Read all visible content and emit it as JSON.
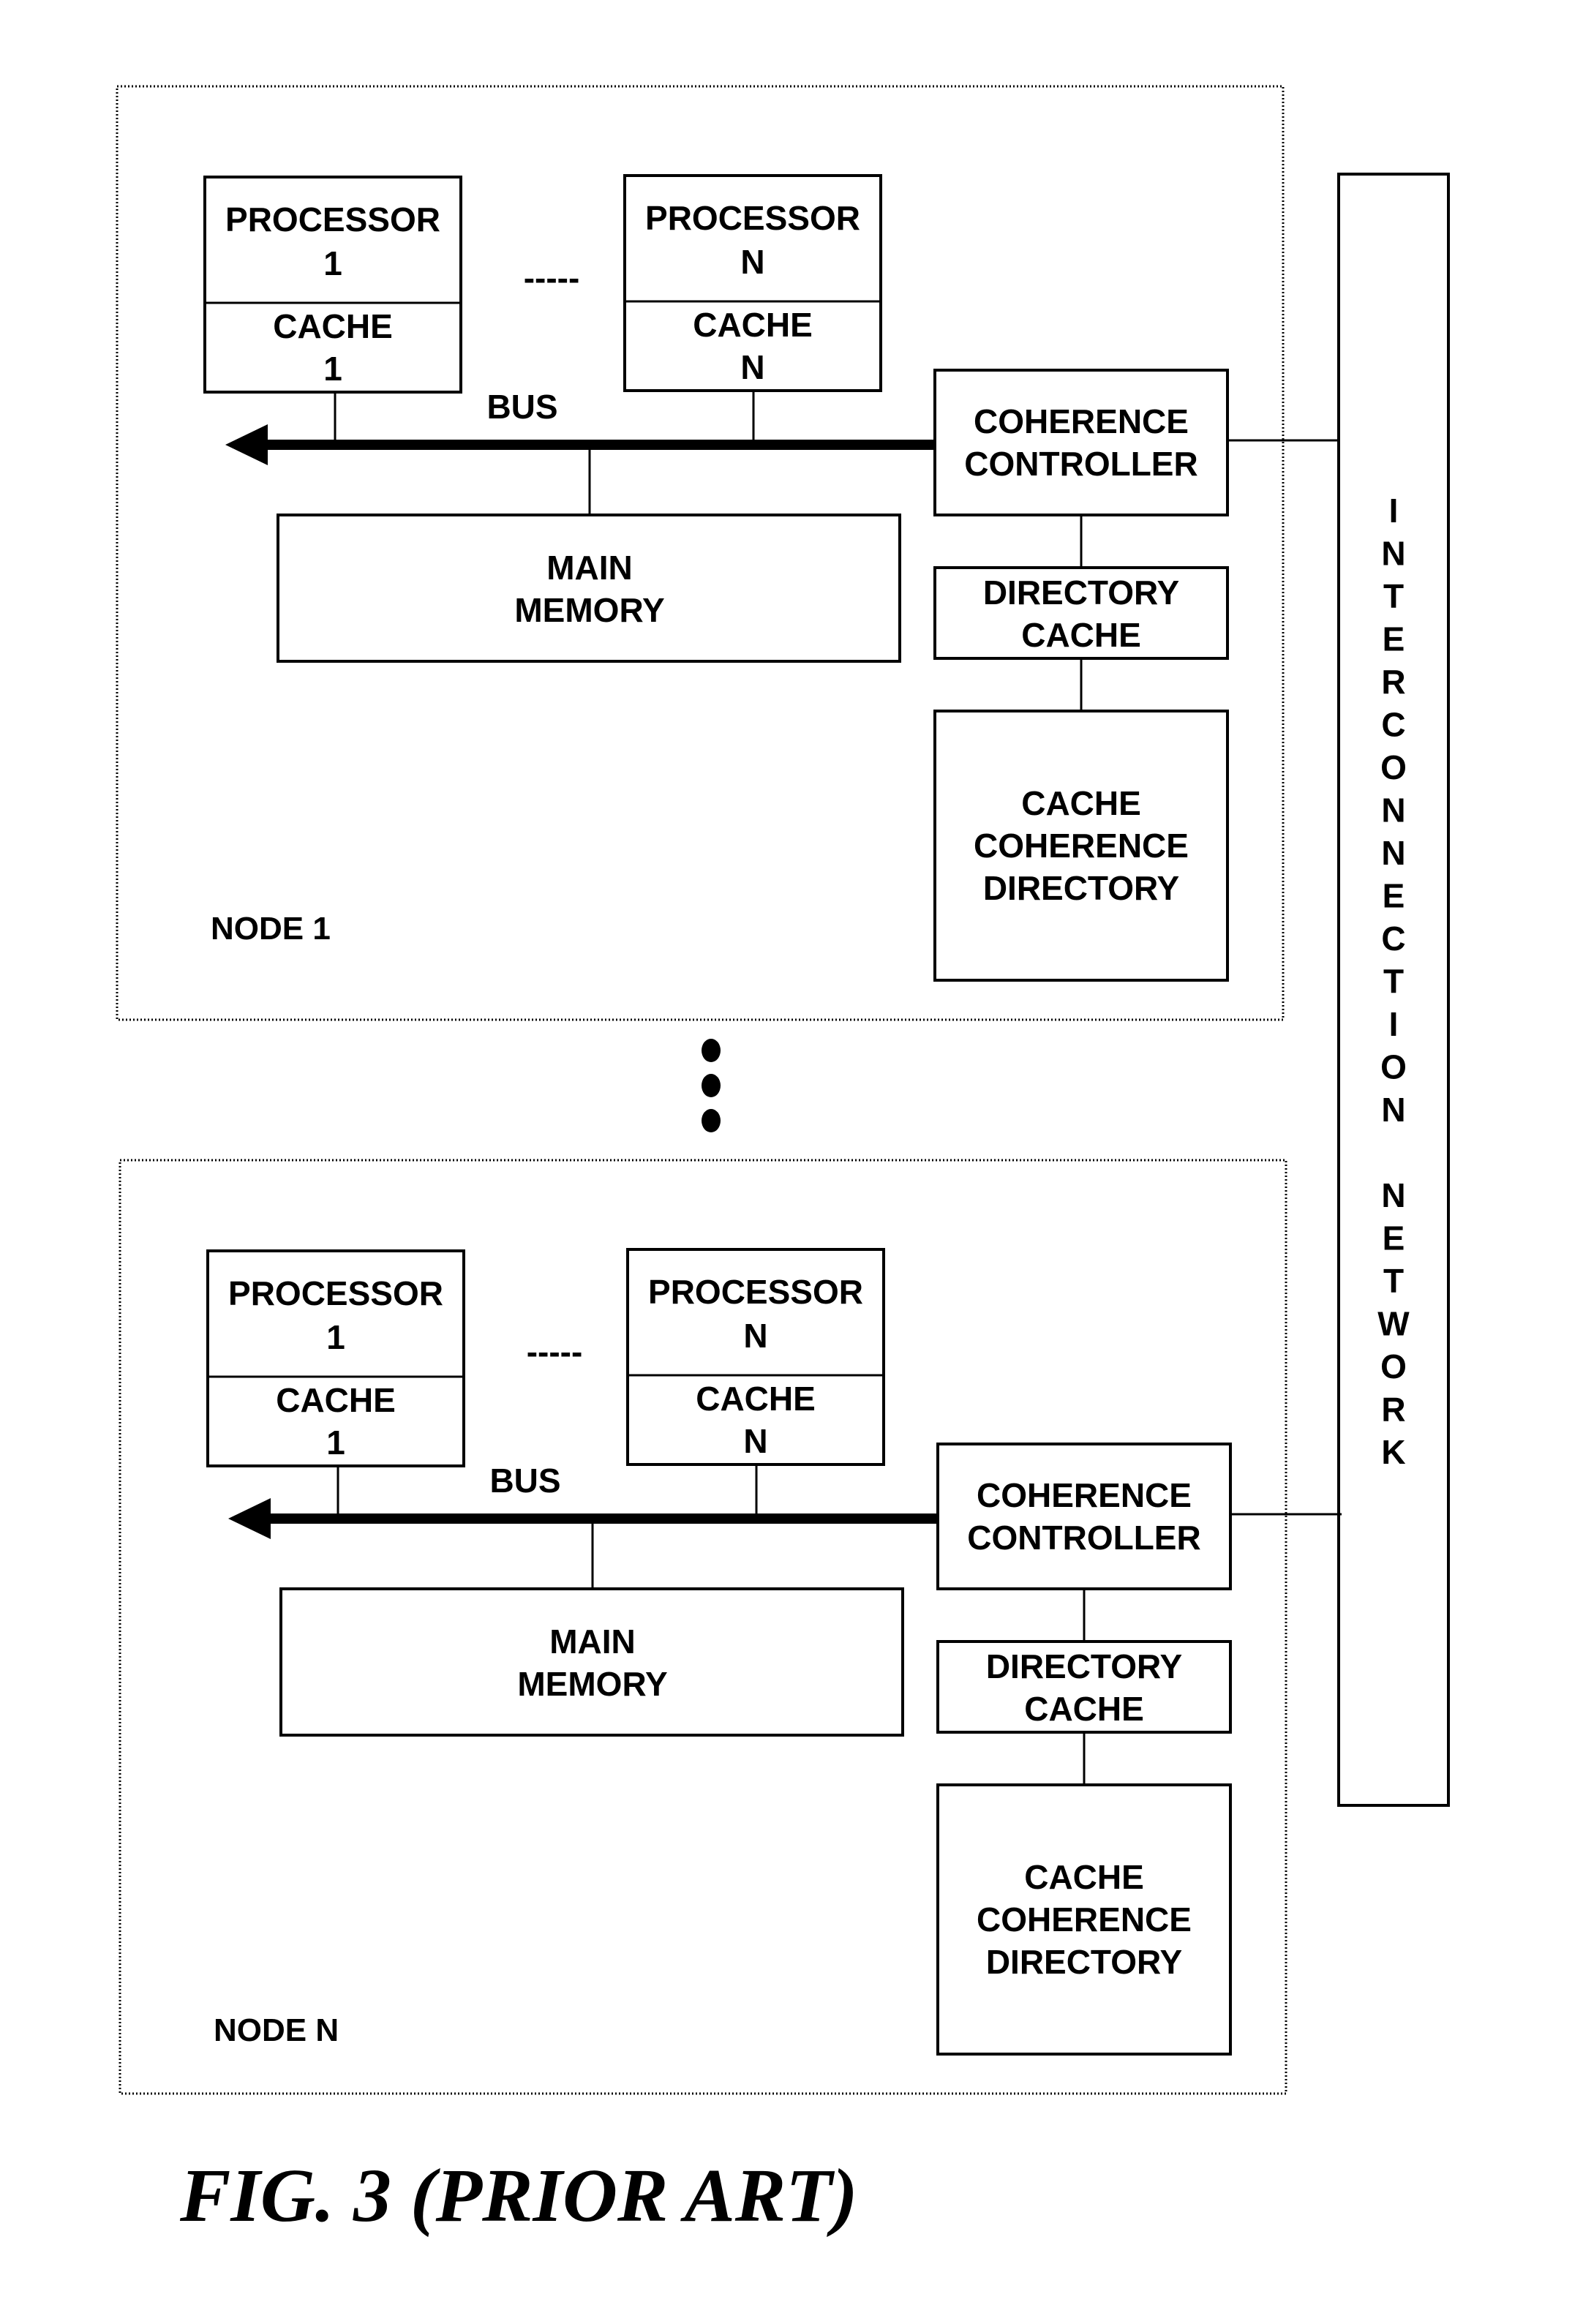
{
  "figure": {
    "caption": "FIG. 3 (PRIOR ART)",
    "interconnect_label": "INTERCONNECTION NETWORK",
    "ellipsis_between_nodes": "vertical-dots"
  },
  "nodes": [
    {
      "label": "NODE 1",
      "processors": [
        {
          "processor_line1": "PROCESSOR",
          "processor_line2": "1",
          "cache_line1": "CACHE",
          "cache_line2": "1"
        },
        {
          "processor_line1": "PROCESSOR",
          "processor_line2": "N",
          "cache_line1": "CACHE",
          "cache_line2": "N"
        }
      ],
      "processor_separator": "-----",
      "bus_label": "BUS",
      "main_memory": [
        "MAIN",
        "MEMORY"
      ],
      "coherence_controller": [
        "COHERENCE",
        "CONTROLLER"
      ],
      "directory_cache": [
        "DIRECTORY",
        "CACHE"
      ],
      "cache_coherence_directory": [
        "CACHE",
        "COHERENCE",
        "DIRECTORY"
      ]
    },
    {
      "label": "NODE N",
      "processors": [
        {
          "processor_line1": "PROCESSOR",
          "processor_line2": "1",
          "cache_line1": "CACHE",
          "cache_line2": "1"
        },
        {
          "processor_line1": "PROCESSOR",
          "processor_line2": "N",
          "cache_line1": "CACHE",
          "cache_line2": "N"
        }
      ],
      "processor_separator": "-----",
      "bus_label": "BUS",
      "main_memory": [
        "MAIN",
        "MEMORY"
      ],
      "coherence_controller": [
        "COHERENCE",
        "CONTROLLER"
      ],
      "directory_cache": [
        "DIRECTORY",
        "CACHE"
      ],
      "cache_coherence_directory": [
        "CACHE",
        "COHERENCE",
        "DIRECTORY"
      ]
    }
  ]
}
